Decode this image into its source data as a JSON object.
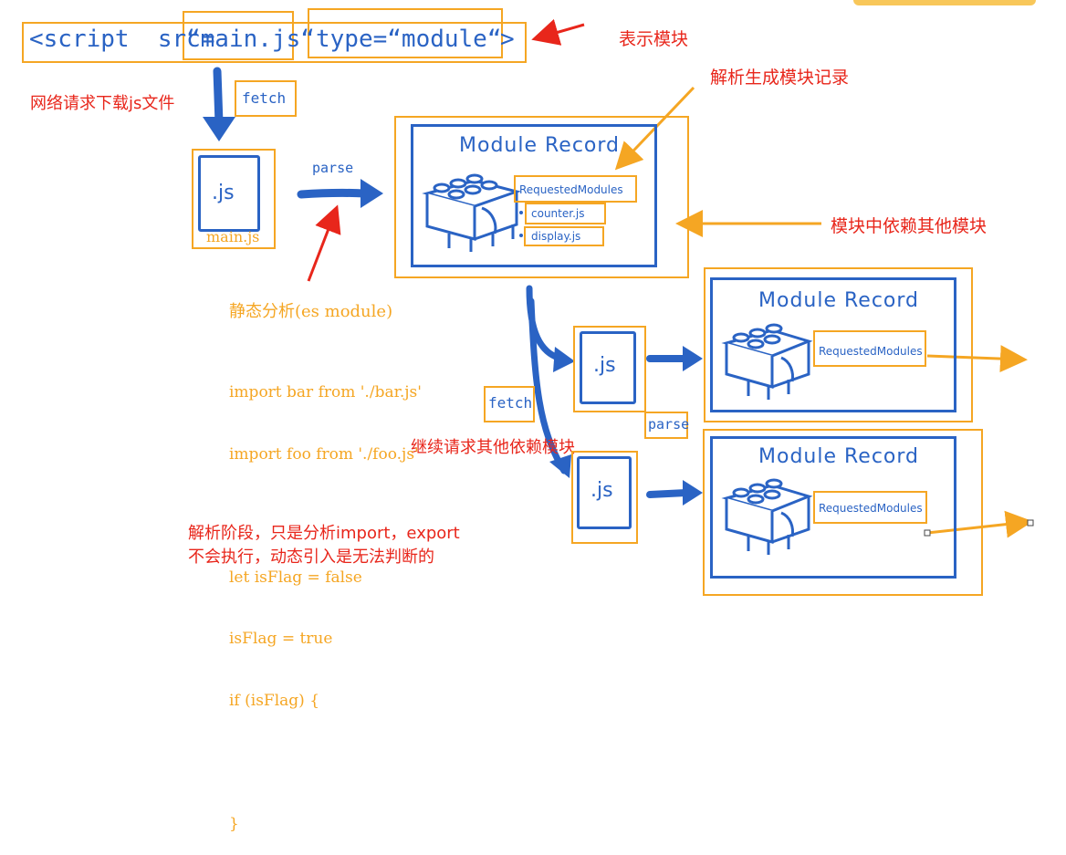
{
  "script_tag": {
    "prefix": "<script  src=",
    "src": "“main.js“",
    "type": "type=“module“",
    "close": ">"
  },
  "annotations": {
    "module_meaning": "表示模块",
    "parse_record": "解析生成模块记录",
    "download": "网络请求下载js文件",
    "deps": "模块中依赖其他模块",
    "continue_fetch": "继续请求其他依赖模块",
    "parse_phase_line1": "解析阶段，只是分析import，export",
    "parse_phase_line2": "不会执行，动态引入是无法判断的"
  },
  "labels": {
    "fetch_top": "fetch",
    "fetch_mid": "fetch",
    "parse_top": "parse",
    "parse_mid": "parse",
    "js": ".js",
    "main_js": "main.js"
  },
  "module_records": [
    {
      "title": "Module Record",
      "requested": "RequestedModules",
      "deps": [
        "counter.js",
        "display.js"
      ]
    },
    {
      "title": "Module Record",
      "requested": "RequestedModules"
    },
    {
      "title": "Module Record",
      "requested": "RequestedModules"
    }
  ],
  "static_analysis": {
    "heading": "静态分析(es module)",
    "code": [
      "import bar from './bar.js'",
      "import foo from './foo.js'",
      "",
      "let isFlag = false",
      "isFlag = true",
      "if (isFlag) {",
      "",
      "}"
    ]
  },
  "colors": {
    "blue": "#2a63c4",
    "orange": "#f5a623",
    "red": "#e8261b"
  }
}
